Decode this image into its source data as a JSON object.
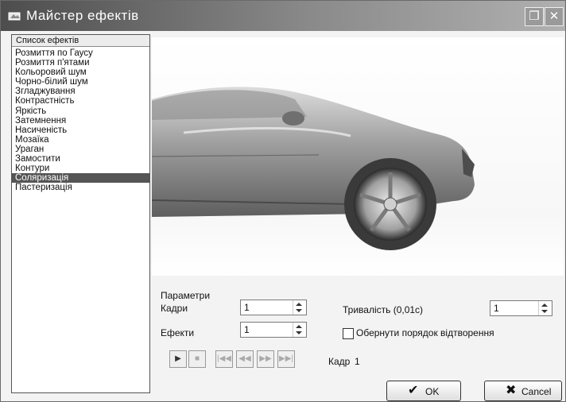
{
  "window": {
    "title": "Майстер ефектів",
    "maximize_icon": "maximize-icon",
    "close_icon": "close-icon"
  },
  "effects_list": {
    "header": "Список ефектів",
    "items": [
      "Розмиття по Гаусу",
      "Розмиття п'ятами",
      "Кольоровий шум",
      "Чорно-білий шум",
      "Згладжування",
      "Контрастність",
      "Яркість",
      "Затемнення",
      "Насиченість",
      "Мозаїка",
      "Ураган",
      "Замостити",
      "Контури",
      "Соляризація",
      "Пастеризація"
    ],
    "selected": "Соляризація"
  },
  "params": {
    "title": "Параметри",
    "frames_label": "Кадри",
    "frames_value": "1",
    "effects_label": "Ефекти",
    "effects_value": "1",
    "duration_label": "Тривалість (0,01с)",
    "duration_value": "1",
    "reverse_label": "Обернути порядок відтворення",
    "reverse_checked": false
  },
  "playback": {
    "frame_label": "Кадр",
    "frame_value": "1"
  },
  "buttons": {
    "ok": "OK",
    "cancel": "Cancel"
  }
}
